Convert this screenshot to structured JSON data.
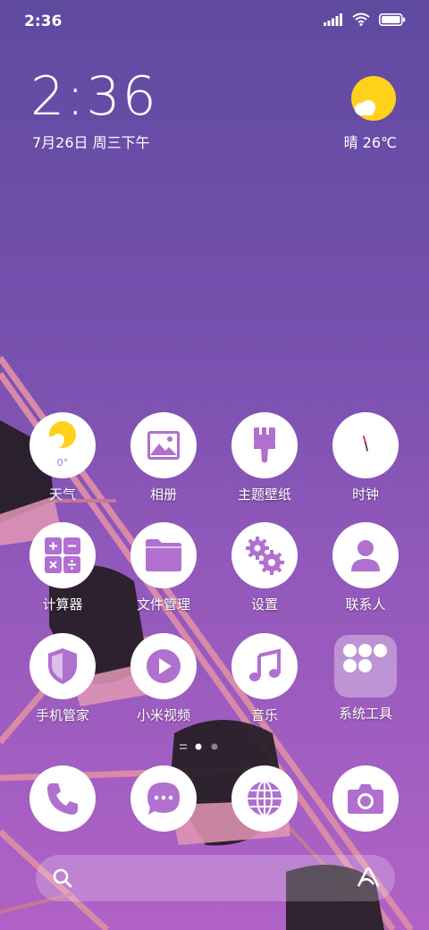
{
  "status_bar": {
    "time": "2:36"
  },
  "clock_widget": {
    "time": "2:36",
    "date": "7月26日 周三下午"
  },
  "weather_widget": {
    "text": "晴 26℃"
  },
  "home_grid": {
    "row1": [
      {
        "label": "天气",
        "icon": "weather-icon",
        "temp": "0°"
      },
      {
        "label": "相册",
        "icon": "gallery-icon"
      },
      {
        "label": "主题壁纸",
        "icon": "paintbrush-icon"
      },
      {
        "label": "时钟",
        "icon": "clock-icon"
      }
    ],
    "row2": [
      {
        "label": "计算器",
        "icon": "calculator-icon"
      },
      {
        "label": "文件管理",
        "icon": "folder-icon"
      },
      {
        "label": "设置",
        "icon": "gears-icon"
      },
      {
        "label": "联系人",
        "icon": "person-icon"
      }
    ],
    "row3": [
      {
        "label": "手机管家",
        "icon": "shield-icon"
      },
      {
        "label": "小米视频",
        "icon": "play-icon"
      },
      {
        "label": "音乐",
        "icon": "music-note-icon"
      },
      {
        "label": "系统工具",
        "icon": "folder-grid-icon"
      }
    ]
  },
  "page_indicator": {
    "pages": 2,
    "current": 1
  },
  "dock": [
    {
      "name": "phone",
      "icon": "phone-icon"
    },
    {
      "name": "messages",
      "icon": "chat-bubble-icon"
    },
    {
      "name": "browser",
      "icon": "globe-icon"
    },
    {
      "name": "camera",
      "icon": "camera-icon"
    }
  ],
  "colors": {
    "icon_purple": "#b070cf",
    "accent_sun": "#ffd11a"
  }
}
